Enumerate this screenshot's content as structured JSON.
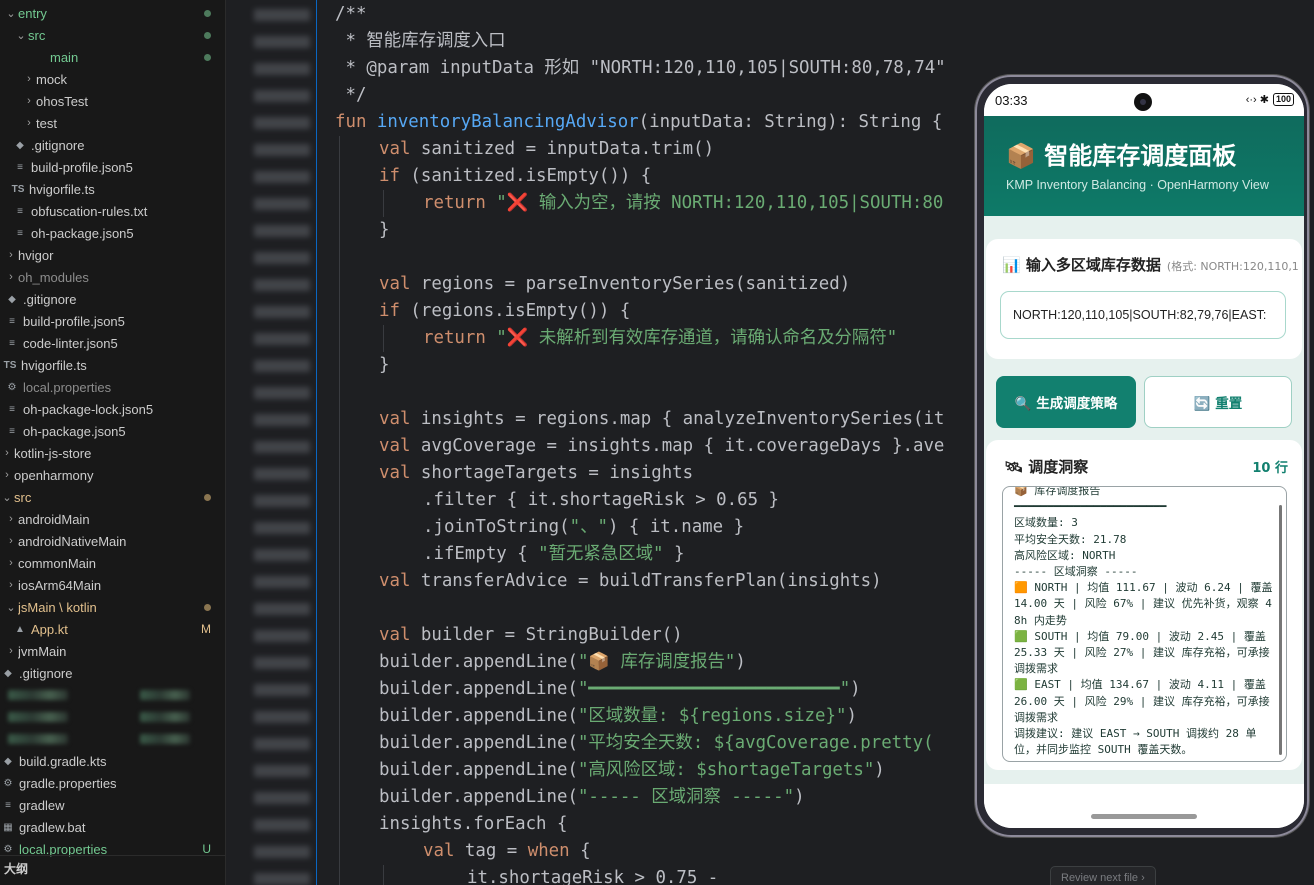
{
  "explorer": {
    "items": [
      {
        "label": "entry",
        "chev": "⌄",
        "indent": 4,
        "color": "green",
        "badge": "dot"
      },
      {
        "label": "src",
        "chev": "⌄",
        "indent": 14,
        "color": "green",
        "badge": "dot"
      },
      {
        "label": "main",
        "chev": "",
        "indent": 36,
        "color": "green",
        "badge": "dot"
      },
      {
        "label": "mock",
        "chev": "›",
        "indent": 22,
        "color": "",
        "badge": ""
      },
      {
        "label": "ohosTest",
        "chev": "›",
        "indent": 22,
        "color": "",
        "badge": ""
      },
      {
        "label": "test",
        "chev": "›",
        "indent": 22,
        "color": "",
        "badge": ""
      },
      {
        "label": ".gitignore",
        "chev": "",
        "indent": 12,
        "icon": "◆",
        "color": "",
        "badge": ""
      },
      {
        "label": "build-profile.json5",
        "chev": "",
        "indent": 12,
        "icon": "≡",
        "color": "",
        "badge": ""
      },
      {
        "label": "hvigorfile.ts",
        "chev": "",
        "indent": 10,
        "icon": "TS",
        "color": "",
        "badge": ""
      },
      {
        "label": "obfuscation-rules.txt",
        "chev": "",
        "indent": 12,
        "icon": "≡",
        "color": "",
        "badge": ""
      },
      {
        "label": "oh-package.json5",
        "chev": "",
        "indent": 12,
        "icon": "≡",
        "color": "",
        "badge": ""
      },
      {
        "label": "hvigor",
        "chev": "›",
        "indent": 4,
        "color": "",
        "badge": ""
      },
      {
        "label": "oh_modules",
        "chev": "›",
        "indent": 4,
        "color": "muted",
        "badge": ""
      },
      {
        "label": ".gitignore",
        "chev": "",
        "indent": 4,
        "icon": "◆",
        "color": "",
        "badge": ""
      },
      {
        "label": "build-profile.json5",
        "chev": "",
        "indent": 4,
        "icon": "≡",
        "color": "",
        "badge": ""
      },
      {
        "label": "code-linter.json5",
        "chev": "",
        "indent": 4,
        "icon": "≡",
        "color": "",
        "badge": ""
      },
      {
        "label": "hvigorfile.ts",
        "chev": "",
        "indent": 2,
        "icon": "TS",
        "color": "",
        "badge": ""
      },
      {
        "label": "local.properties",
        "chev": "",
        "indent": 4,
        "icon": "⚙",
        "color": "muted",
        "badge": ""
      },
      {
        "label": "oh-package-lock.json5",
        "chev": "",
        "indent": 4,
        "icon": "≡",
        "color": "",
        "badge": ""
      },
      {
        "label": "oh-package.json5",
        "chev": "",
        "indent": 4,
        "icon": "≡",
        "color": "",
        "badge": ""
      },
      {
        "label": "kotlin-js-store",
        "chev": "›",
        "indent": -4,
        "color": "",
        "badge": ""
      },
      {
        "label": "openharmony",
        "chev": "›",
        "indent": -4,
        "color": "",
        "badge": ""
      },
      {
        "label": "src",
        "chev": "⌄",
        "indent": -4,
        "color": "orange",
        "badge": "dot"
      },
      {
        "label": "androidMain",
        "chev": "›",
        "indent": 4,
        "color": "",
        "badge": ""
      },
      {
        "label": "androidNativeMain",
        "chev": "›",
        "indent": 4,
        "color": "",
        "badge": ""
      },
      {
        "label": "commonMain",
        "chev": "›",
        "indent": 4,
        "color": "",
        "badge": ""
      },
      {
        "label": "iosArm64Main",
        "chev": "›",
        "indent": 4,
        "color": "",
        "badge": ""
      },
      {
        "label": "jsMain \\ kotlin",
        "chev": "⌄",
        "indent": 4,
        "color": "orange",
        "badge": "dot"
      },
      {
        "label": "App.kt",
        "chev": "",
        "indent": 12,
        "icon": "K",
        "color": "orange",
        "badge": "M"
      },
      {
        "label": "jvmMain",
        "chev": "›",
        "indent": 4,
        "color": "",
        "badge": ""
      },
      {
        "label": ".gitignore",
        "chev": "",
        "indent": -4,
        "icon": "◆",
        "color": "",
        "badge": ""
      },
      {
        "label": "",
        "chev": "",
        "indent": 0,
        "color": "",
        "badge": "",
        "blurred": true
      },
      {
        "label": "",
        "chev": "",
        "indent": 0,
        "color": "",
        "badge": "",
        "blurred": true
      },
      {
        "label": "",
        "chev": "",
        "indent": 0,
        "color": "",
        "badge": "",
        "blurred": true
      },
      {
        "label": "build.gradle.kts",
        "chev": "",
        "indent": -4,
        "icon": "◆",
        "color": "",
        "badge": ""
      },
      {
        "label": "gradle.properties",
        "chev": "",
        "indent": -4,
        "icon": "⚙",
        "color": "",
        "badge": ""
      },
      {
        "label": "gradlew",
        "chev": "",
        "indent": -4,
        "icon": "≡",
        "color": "",
        "badge": ""
      },
      {
        "label": "gradlew.bat",
        "chev": "",
        "indent": -4,
        "icon": "▦",
        "color": "",
        "badge": ""
      },
      {
        "label": "local.properties",
        "chev": "",
        "indent": -4,
        "icon": "⚙",
        "color": "green",
        "badge": "U"
      }
    ],
    "outline_label": "大纲"
  },
  "code": {
    "lines": [
      {
        "i": 0,
        "t": [
          [
            "cm",
            "/**"
          ]
        ]
      },
      {
        "i": 0,
        "t": [
          [
            "cm",
            " * 智能库存调度入口"
          ]
        ]
      },
      {
        "i": 0,
        "t": [
          [
            "cm",
            " * @param inputData 形如 \"NORTH:120,110,105|SOUTH:80,78,74\""
          ]
        ]
      },
      {
        "i": 0,
        "t": [
          [
            "cm",
            " */"
          ]
        ]
      },
      {
        "i": 0,
        "t": [
          [
            "kw",
            "fun "
          ],
          [
            "fn",
            "inventoryBalancingAdvisor"
          ],
          [
            "",
            "(inputData: String): String {"
          ]
        ]
      },
      {
        "i": 1,
        "t": [
          [
            "kw",
            "val "
          ],
          [
            "",
            "sanitized = inputData.trim()"
          ]
        ]
      },
      {
        "i": 1,
        "t": [
          [
            "kw",
            "if "
          ],
          [
            "",
            "(sanitized.isEmpty()) {"
          ]
        ]
      },
      {
        "i": 2,
        "t": [
          [
            "kw",
            "return "
          ],
          [
            "str",
            "\"❌ 输入为空，请按 NORTH:120,110,105|SOUTH:80"
          ]
        ]
      },
      {
        "i": 1,
        "t": [
          [
            "",
            "}"
          ]
        ]
      },
      {
        "i": 1,
        "t": [
          [
            "",
            ""
          ]
        ]
      },
      {
        "i": 1,
        "t": [
          [
            "kw",
            "val "
          ],
          [
            "",
            "regions = parseInventorySeries(sanitized)"
          ]
        ]
      },
      {
        "i": 1,
        "t": [
          [
            "kw",
            "if "
          ],
          [
            "",
            "(regions.isEmpty()) {"
          ]
        ]
      },
      {
        "i": 2,
        "t": [
          [
            "kw",
            "return "
          ],
          [
            "str",
            "\"❌ 未解析到有效库存通道，请确认命名及分隔符\""
          ]
        ]
      },
      {
        "i": 1,
        "t": [
          [
            "",
            "}"
          ]
        ]
      },
      {
        "i": 1,
        "t": [
          [
            "",
            ""
          ]
        ]
      },
      {
        "i": 1,
        "t": [
          [
            "kw",
            "val "
          ],
          [
            "",
            "insights = regions.map { analyzeInventorySeries(it"
          ]
        ]
      },
      {
        "i": 1,
        "t": [
          [
            "kw",
            "val "
          ],
          [
            "",
            "avgCoverage = insights.map { it.coverageDays }.ave"
          ]
        ]
      },
      {
        "i": 1,
        "t": [
          [
            "kw",
            "val "
          ],
          [
            "",
            "shortageTargets = insights"
          ]
        ]
      },
      {
        "i": 2,
        "t": [
          [
            "",
            ".filter { it.shortageRisk > 0.65 }"
          ]
        ]
      },
      {
        "i": 2,
        "t": [
          [
            "",
            ".joinToString("
          ],
          [
            "str",
            "\"、\""
          ],
          [
            "",
            ") { it.name }"
          ]
        ]
      },
      {
        "i": 2,
        "t": [
          [
            "",
            ".ifEmpty { "
          ],
          [
            "str",
            "\"暂无紧急区域\""
          ],
          [
            "",
            " }"
          ]
        ]
      },
      {
        "i": 1,
        "t": [
          [
            "kw",
            "val "
          ],
          [
            "",
            "transferAdvice = buildTransferPlan(insights)"
          ]
        ]
      },
      {
        "i": 1,
        "t": [
          [
            "",
            ""
          ]
        ]
      },
      {
        "i": 1,
        "t": [
          [
            "kw",
            "val "
          ],
          [
            "",
            "builder = StringBuilder()"
          ]
        ]
      },
      {
        "i": 1,
        "t": [
          [
            "",
            "builder.appendLine("
          ],
          [
            "str",
            "\"📦 库存调度报告\""
          ],
          [
            "",
            ")"
          ]
        ]
      },
      {
        "i": 1,
        "t": [
          [
            "",
            "builder.appendLine("
          ],
          [
            "str",
            "\"━━━━━━━━━━━━━━━━━━━━━━━━\""
          ],
          [
            "",
            ")"
          ]
        ]
      },
      {
        "i": 1,
        "t": [
          [
            "",
            "builder.appendLine("
          ],
          [
            "str",
            "\"区域数量: ${regions.size}\""
          ],
          [
            "",
            ")"
          ]
        ]
      },
      {
        "i": 1,
        "t": [
          [
            "",
            "builder.appendLine("
          ],
          [
            "str",
            "\"平均安全天数: ${avgCoverage.pretty("
          ]
        ]
      },
      {
        "i": 1,
        "t": [
          [
            "",
            "builder.appendLine("
          ],
          [
            "str",
            "\"高风险区域: $shortageTargets\""
          ],
          [
            "",
            ")"
          ]
        ]
      },
      {
        "i": 1,
        "t": [
          [
            "",
            "builder.appendLine("
          ],
          [
            "str",
            "\"----- 区域洞察 -----\""
          ],
          [
            "",
            ")"
          ]
        ]
      },
      {
        "i": 1,
        "t": [
          [
            "",
            "insights.forEach {"
          ]
        ]
      },
      {
        "i": 2,
        "t": [
          [
            "kw",
            "val "
          ],
          [
            "",
            "tag = "
          ],
          [
            "kw",
            "when"
          ],
          [
            "",
            " {"
          ]
        ]
      },
      {
        "i": 3,
        "t": [
          [
            "",
            "it.shortageRisk > 0.75 -"
          ]
        ]
      }
    ],
    "review_hint": "Review next file ›"
  },
  "phone": {
    "time": "03:33",
    "status_icons": "‹·› ✱",
    "battery": "100",
    "title": "📦 智能库存调度面板",
    "subtitle": "KMP Inventory Balancing · OpenHarmony View",
    "input_card": {
      "title": "📊 输入多区域库存数据",
      "hint": "(格式: NORTH:120,110,1",
      "value": "NORTH:120,110,105|SOUTH:82,79,76|EAST:"
    },
    "buttons": {
      "generate": "🔍 生成调度策略",
      "reset": "🔄 重置"
    },
    "insights": {
      "title": "🛰 调度洞察",
      "count": "10 行",
      "result": "📦 库存调度报告\n━━━━━━━━━━━━━━━━━━━━━━━\n区域数量: 3\n平均安全天数: 21.78\n高风险区域: NORTH\n----- 区域洞察 -----\n🟧 NORTH | 均值 111.67 | 波动 6.24 | 覆盖 14.00 天 | 风险 67% | 建议 优先补货，观察 48h 内走势\n🟩 SOUTH | 均值 79.00 | 波动 2.45 | 覆盖 25.33 天 | 风险 27% | 建议 库存充裕，可承接调拨需求\n🟩 EAST | 均值 134.67 | 波动 4.11 | 覆盖 26.00 天 | 风险 29% | 建议 库存充裕，可承接调拨需求\n调拨建议: 建议 EAST → SOUTH 调拨约 28 单位，并同步监控 SOUTH 覆盖天数。"
    }
  }
}
